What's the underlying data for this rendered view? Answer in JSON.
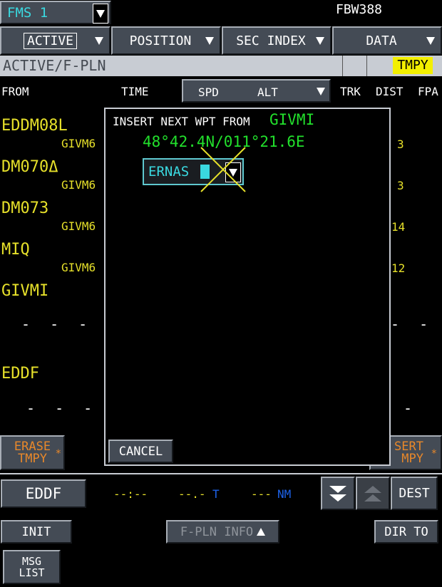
{
  "top": {
    "fms_label": "FMS 1",
    "flight_id": "FBW388"
  },
  "tabs": [
    {
      "label": "ACTIVE"
    },
    {
      "label": "POSITION"
    },
    {
      "label": "SEC INDEX"
    },
    {
      "label": "DATA"
    }
  ],
  "page_title": "ACTIVE/F-PLN",
  "tmpy_label": "TMPY",
  "columns": {
    "from": "FROM",
    "time": "TIME",
    "spd": "SPD",
    "alt": "ALT",
    "trk": "TRK",
    "dist": "DIST",
    "fpa": "FPA"
  },
  "waypoints": [
    {
      "name": "EDDM08L",
      "airway": "GIVM6",
      "dist": "3"
    },
    {
      "name": "DM070Δ",
      "airway": "GIVM6",
      "dist": "3"
    },
    {
      "name": "DM073",
      "airway": "GIVM6",
      "dist": "14"
    },
    {
      "name": "MIQ",
      "airway": "GIVM6",
      "dist": "12"
    },
    {
      "name": "GIVMI"
    },
    {
      "name": "EDDF"
    }
  ],
  "discontinuity": {
    "left": "- - - -",
    "right": "- -",
    "right2": "-"
  },
  "left_button": {
    "line1": "ERASE",
    "line2": "TMPY",
    "star": "*"
  },
  "right_button": {
    "line1": "SERT",
    "line2": "MPY",
    "star": "*"
  },
  "dialog": {
    "title": "INSERT NEXT WPT FROM",
    "from_wpt": "GIVMI",
    "coords": "48°42.4N/011°21.6E",
    "input_value": "ERNAS",
    "cancel_label": "CANCEL"
  },
  "bottom": {
    "dest_field": "EDDF",
    "time": "--:--",
    "efob": "--.-",
    "efob_unit": "T",
    "dist": "---",
    "dist_unit": "NM",
    "dest_button": "DEST",
    "init_button": "INIT",
    "fpln_info_button": "F-PLN INFO",
    "dir_to_button": "DIR TO",
    "msg_list_line1": "MSG",
    "msg_list_line2": "LIST"
  }
}
